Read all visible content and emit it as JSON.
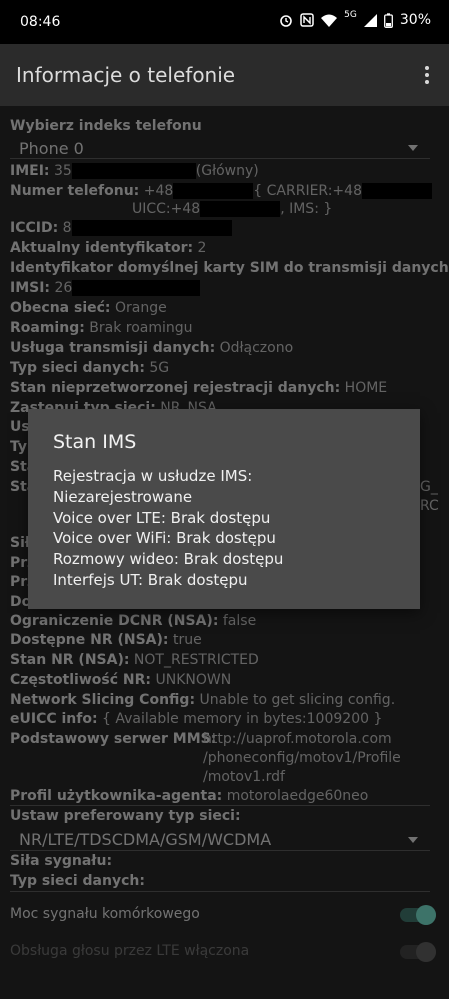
{
  "status_bar": {
    "time": "08:46",
    "network": "5G",
    "battery": "30%"
  },
  "app_bar": {
    "title": "Informacje o telefonie"
  },
  "phone_index": {
    "label": "Wybierz indeks telefonu",
    "value": "Phone 0"
  },
  "info": {
    "imei": {
      "label": "IMEI:",
      "value_prefix": "35",
      "value_suffix": "(Główny)"
    },
    "phone_number": {
      "label": "Numer telefonu:",
      "value_part1": "+48",
      "carrier_part": "{ CARRIER:+48",
      "uicc_part": "UICC:+48",
      "ims_part": ", IMS: }"
    },
    "iccid": {
      "label": "ICCID:",
      "value_prefix": "8"
    },
    "current_id": {
      "label": "Aktualny identyfikator:",
      "value": "2"
    },
    "default_data_sim": {
      "label": "Identyfikator domyślnej karty SIM do transmisji danych:",
      "value": "2"
    },
    "imsi": {
      "label": "IMSI:",
      "value_prefix": "26"
    },
    "current_network": {
      "label": "Obecna sieć:",
      "value": "Orange"
    },
    "roaming": {
      "label": "Roaming:",
      "value": "Brak roamingu"
    },
    "data_service": {
      "label": "Usługa transmisji danych:",
      "value": "Odłączono"
    },
    "network_type": {
      "label": "Typ sieci danych:",
      "value": "5G"
    },
    "raw_data_registration": {
      "label": "Stan nieprzetworzonej rejestracji danych:",
      "value": "HOME"
    },
    "override_network": {
      "label": "Zastępuj typ sieci:",
      "value": "NR_NSA"
    },
    "partial_1": {
      "label": "Us"
    },
    "partial_2": {
      "label": "Typ"
    },
    "partial_3": {
      "label": "Sta"
    },
    "partial_4": {
      "label": "Sta",
      "right1": "G_",
      "right2": "RC"
    },
    "partial_5": {
      "label": "Sił"
    },
    "partial_6": {
      "label": "Prz"
    },
    "partial_7": {
      "label": "Prz"
    },
    "partial_8": {
      "label": "Do"
    },
    "dcnr": {
      "label": "Ograniczenie DCNR (NSA):",
      "value": "false"
    },
    "nr_available": {
      "label": "Dostępne NR (NSA):",
      "value": "true"
    },
    "nr_state": {
      "label": "Stan NR (NSA):",
      "value": "NOT_RESTRICTED"
    },
    "nr_frequency": {
      "label": "Częstotliwość NR:",
      "value": "UNKNOWN"
    },
    "slicing": {
      "label": "Network Slicing Config:",
      "value": "Unable to get slicing config."
    },
    "euicc": {
      "label": "eUICC info:",
      "value": "{ Available memory in bytes:1009200 }"
    },
    "mms": {
      "label": "Podstawowy serwer MMS:",
      "line1": "http://uaprof.motorola.com",
      "line2": "/phoneconfig/motov1/Profile",
      "line3": "/motov1.rdf"
    },
    "user_agent": {
      "label": "Profil użytkownika-agenta:",
      "value": "motorolaedge60neo"
    }
  },
  "preferred_network": {
    "label": "Ustaw preferowany typ sieci:",
    "value": "NR/LTE/TDSCDMA/GSM/WCDMA"
  },
  "signal_strength": {
    "label": "Siła sygnału:"
  },
  "data_network_type": {
    "label": "Typ sieci danych:"
  },
  "toggles": {
    "cell_signal": {
      "label": "Moc sygnału komórkowego",
      "on": true
    },
    "volte": {
      "label": "Obsługa głosu przez LTE włączona",
      "on": false
    }
  },
  "dialog": {
    "title": "Stan IMS",
    "lines": [
      "Rejestracja w usłudze IMS:",
      "Niezarejestrowane",
      "Voice over LTE: Brak dostępu",
      "Voice over WiFi: Brak dostępu",
      "Rozmowy wideo: Brak dostępu",
      "Interfejs UT: Brak dostępu"
    ]
  },
  "colors": {
    "accent": "#6fd2c0",
    "toggle_track_on": "#3d6f66",
    "dialog_bg": "#4a4a4a"
  }
}
